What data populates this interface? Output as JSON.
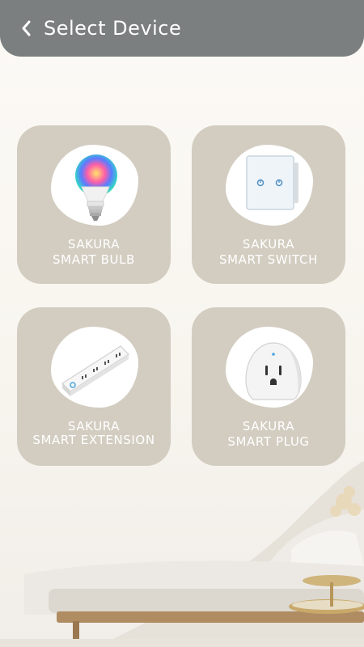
{
  "header": {
    "title": "Select Device",
    "back_icon": "chevron-left-icon"
  },
  "devices": [
    {
      "line1": "SAKURA",
      "line2": "SMART BULB",
      "icon": "bulb-icon"
    },
    {
      "line1": "SAKURA",
      "line2": "SMART SWITCH",
      "icon": "switch-icon"
    },
    {
      "line1": "SAKURA",
      "line2": "SMART EXTENSION",
      "icon": "extension-icon"
    },
    {
      "line1": "SAKURA",
      "line2": "SMART PLUG",
      "icon": "plug-icon"
    }
  ],
  "colors": {
    "header_bg": "#7b7f80",
    "card_bg": "#d3cdc1",
    "page_bg": "#f8f5ef"
  }
}
